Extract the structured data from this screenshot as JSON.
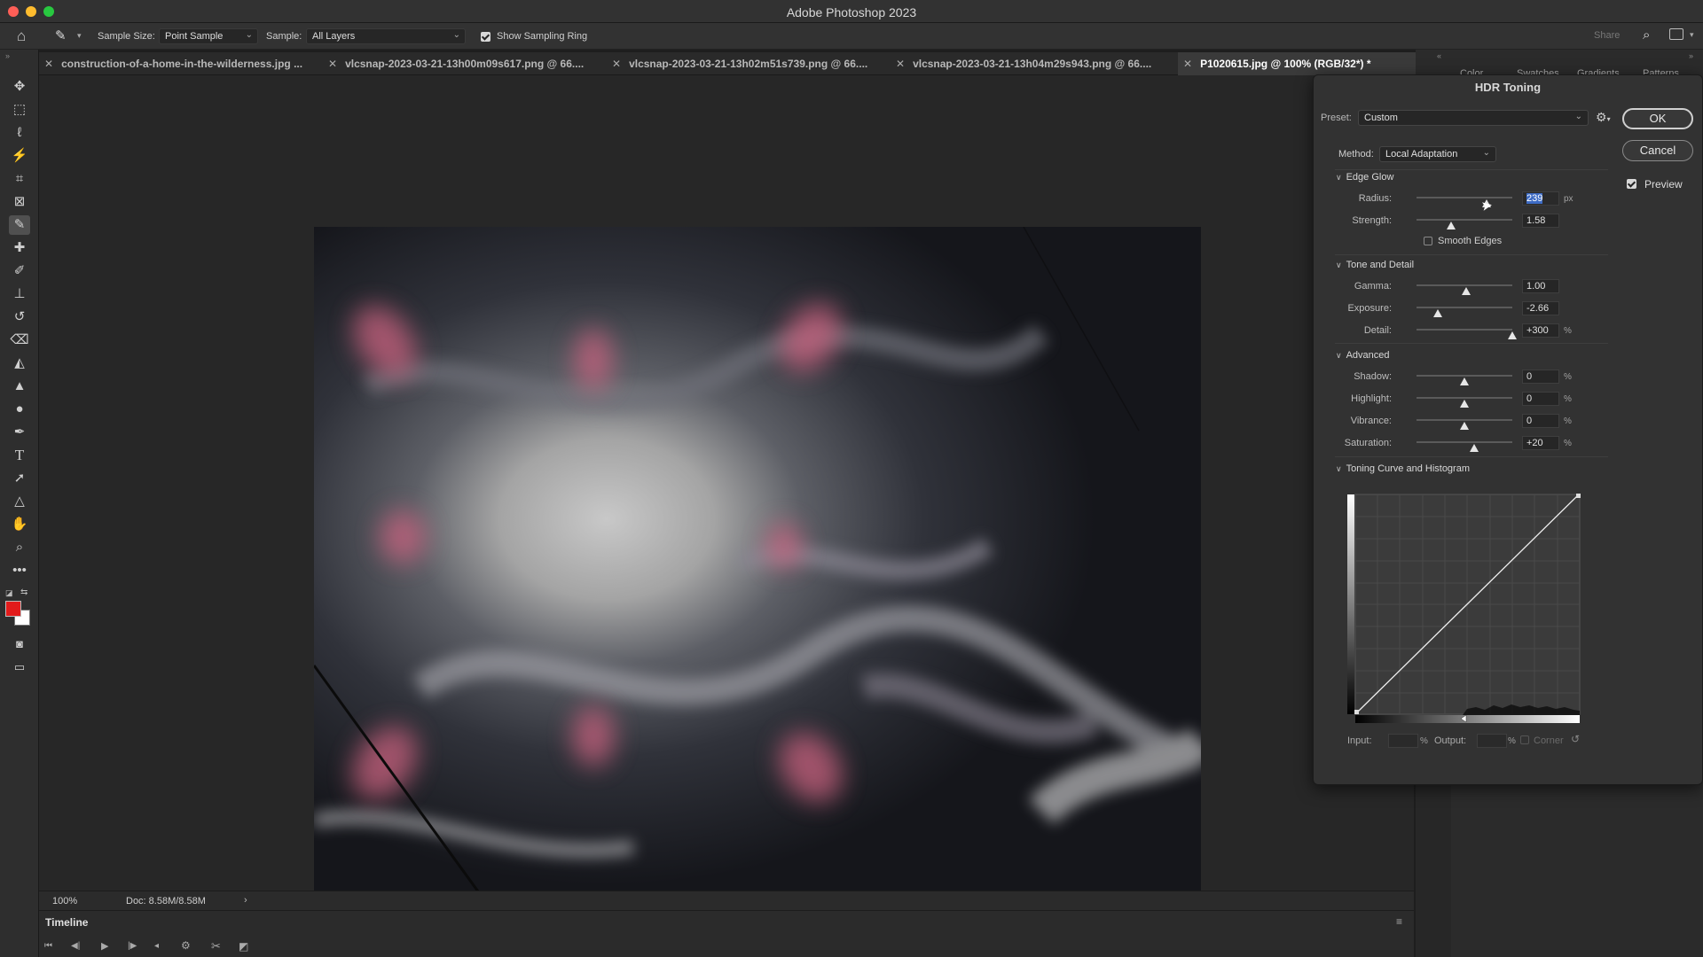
{
  "window": {
    "title": "Adobe Photoshop 2023"
  },
  "options_bar": {
    "sample_size_label": "Sample Size:",
    "sample_size_value": "Point Sample",
    "sample_label": "Sample:",
    "sample_value": "All Layers",
    "show_ring_label": "Show Sampling Ring",
    "show_ring_checked": true,
    "share_label": "Share"
  },
  "tabs": [
    {
      "label": "construction-of-a-home-in-the-wilderness.jpg ...",
      "active": false
    },
    {
      "label": "vlcsnap-2023-03-21-13h00m09s617.png @ 66....",
      "active": false
    },
    {
      "label": "vlcsnap-2023-03-21-13h02m51s739.png @ 66....",
      "active": false
    },
    {
      "label": "vlcsnap-2023-03-21-13h04m29s943.png @ 66....",
      "active": false
    },
    {
      "label": "P1020615.jpg @ 100% (RGB/32*) *",
      "active": true
    }
  ],
  "right_panel_tabs": [
    "Color",
    "Swatches",
    "Gradients",
    "Patterns"
  ],
  "status": {
    "zoom": "100%",
    "doc": "Doc: 8.58M/8.58M"
  },
  "timeline": {
    "title": "Timeline"
  },
  "colors": {
    "foreground": "#e21b1b",
    "background": "#ffffff",
    "accent_selection": "#3d6bc4"
  },
  "hdr": {
    "title": "HDR Toning",
    "preset_label": "Preset:",
    "preset_value": "Custom",
    "method_label": "Method:",
    "method_value": "Local Adaptation",
    "ok": "OK",
    "cancel": "Cancel",
    "preview_label": "Preview",
    "preview_checked": true,
    "edge_glow": {
      "title": "Edge Glow",
      "radius_label": "Radius:",
      "radius_value": "239",
      "radius_unit": "px",
      "radius_pos": 0.73,
      "strength_label": "Strength:",
      "strength_value": "1.58",
      "strength_pos": 0.36,
      "smooth_label": "Smooth Edges",
      "smooth_checked": false
    },
    "tone_detail": {
      "title": "Tone and Detail",
      "gamma_label": "Gamma:",
      "gamma_value": "1.00",
      "gamma_pos": 0.52,
      "exposure_label": "Exposure:",
      "exposure_value": "-2.66",
      "exposure_pos": 0.22,
      "detail_label": "Detail:",
      "detail_value": "+300",
      "detail_unit": "%",
      "detail_pos": 1.0
    },
    "advanced": {
      "title": "Advanced",
      "shadow_label": "Shadow:",
      "shadow_value": "0",
      "shadow_unit": "%",
      "shadow_pos": 0.5,
      "highlight_label": "Highlight:",
      "highlight_value": "0",
      "highlight_unit": "%",
      "highlight_pos": 0.5,
      "vibrance_label": "Vibrance:",
      "vibrance_value": "0",
      "vibrance_unit": "%",
      "vibrance_pos": 0.5,
      "saturation_label": "Saturation:",
      "saturation_value": "+20",
      "saturation_unit": "%",
      "saturation_pos": 0.6
    },
    "curve": {
      "title": "Toning Curve and Histogram",
      "input_label": "Input:",
      "input_unit": "%",
      "output_label": "Output:",
      "output_unit": "%",
      "corner_label": "Corner"
    }
  }
}
